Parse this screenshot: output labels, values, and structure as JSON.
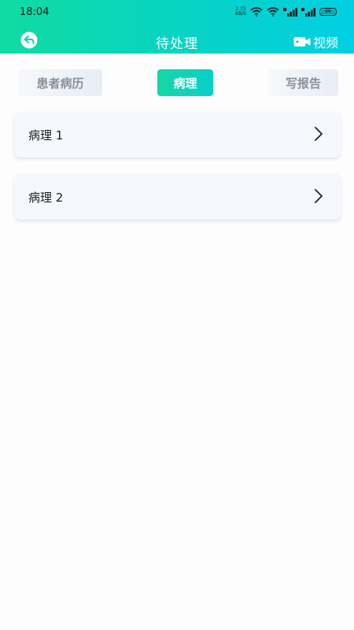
{
  "status_bar": {
    "time": "18:04",
    "net_speed_value": "2.15",
    "net_speed_unit": "KB/S",
    "battery": "96",
    "icons": [
      "wifi-icon",
      "wifi-icon",
      "signal-icon",
      "signal-icon",
      "battery-icon"
    ]
  },
  "header": {
    "title": "待处理",
    "back_icon": "back-arrow-icon",
    "video_icon": "video-camera-icon",
    "video_label": "视频",
    "gradient_start": "#10dba2",
    "gradient_end": "#01cfe2"
  },
  "tabs": [
    {
      "label": "患者病历",
      "active": false
    },
    {
      "label": "病理",
      "active": true
    },
    {
      "label": "写报告",
      "active": false
    }
  ],
  "items": [
    {
      "label": "病理 1"
    },
    {
      "label": "病理 2"
    }
  ],
  "colors": {
    "accent": "#12d8b0",
    "inactive_tab_text": "#8a8f99",
    "card_bg": "#f5f8fc"
  }
}
